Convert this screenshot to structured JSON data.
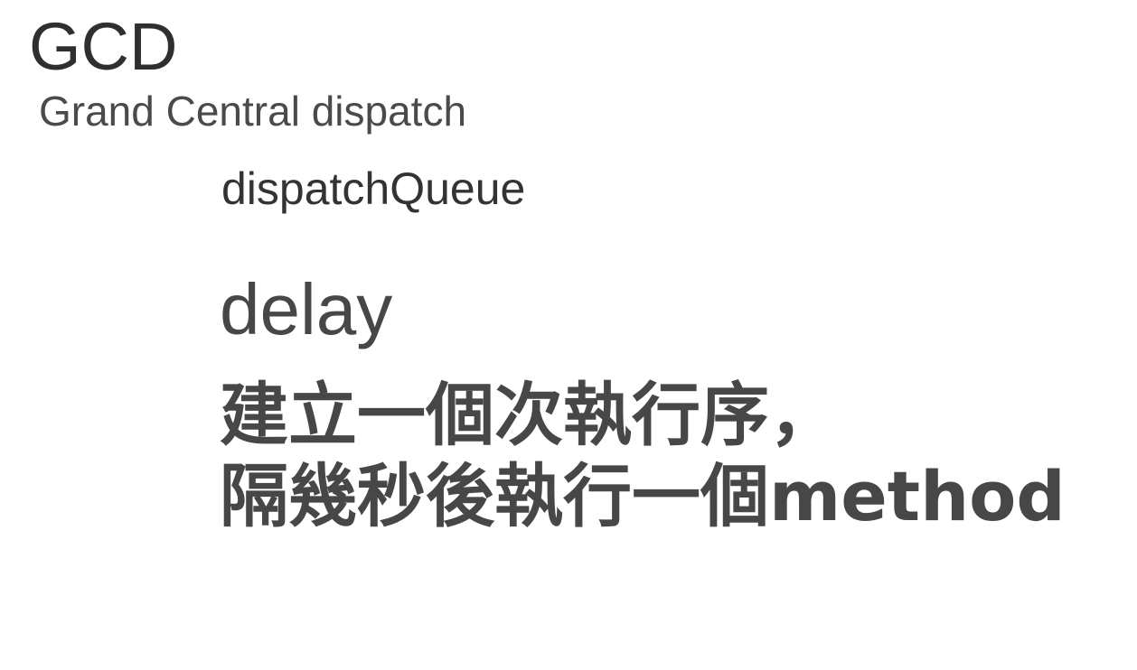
{
  "slide": {
    "title": "GCD",
    "subtitle": "Grand Central dispatch",
    "topic": "dispatchQueue",
    "keyword": "delay",
    "description_lines": [
      "建立一個次執行序，",
      "隔幾秒後執行一個method"
    ]
  },
  "colors": {
    "background": "#ffffff",
    "title_text": "#2f2f2f",
    "body_text": "#474747"
  }
}
